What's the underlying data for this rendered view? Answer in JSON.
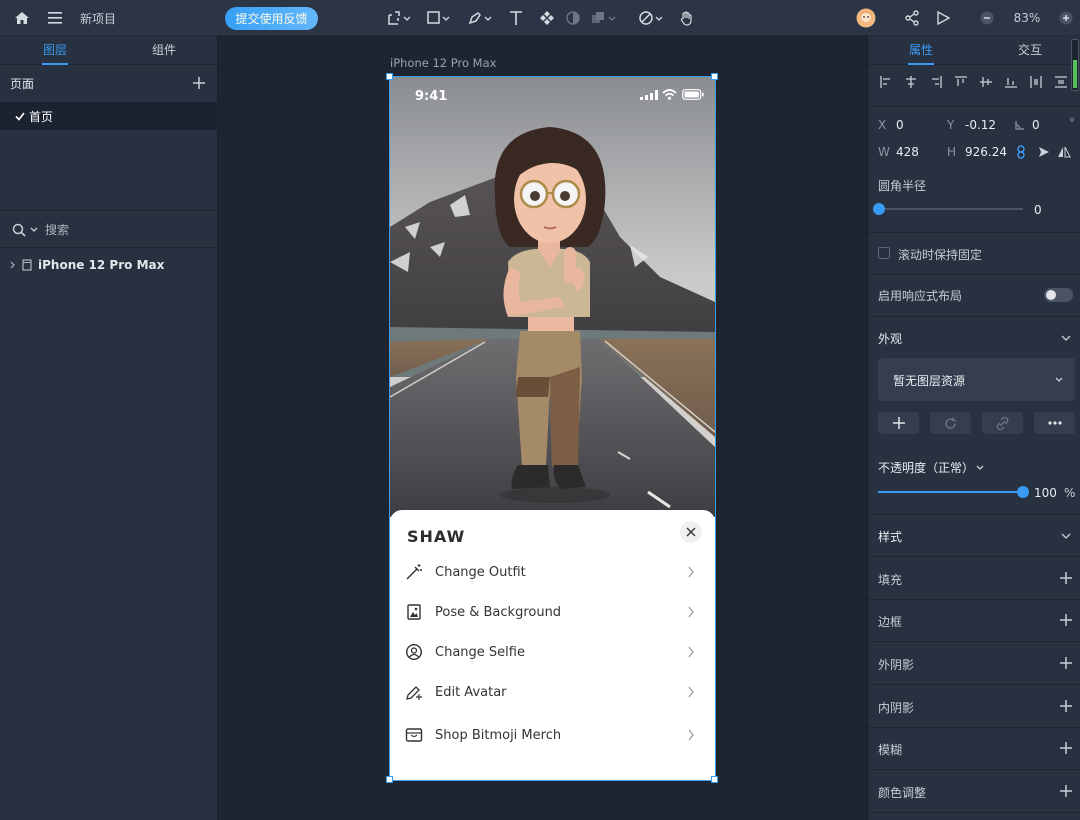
{
  "topbar": {
    "project_name": "新项目",
    "feedback_label": "提交使用反馈",
    "zoom": "83%"
  },
  "left_panel": {
    "tabs": [
      "图层",
      "组件"
    ],
    "pages_header": "页面",
    "page_item": "首页",
    "search_placeholder": "搜索",
    "layer_name": "iPhone 12 Pro Max"
  },
  "canvas": {
    "artboard_label": "iPhone 12 Pro Max",
    "phone": {
      "status_time": "9:41",
      "sheet_title": "SHAW",
      "menu": [
        {
          "label": "Change Outfit",
          "icon": "magic-wand-icon"
        },
        {
          "label": "Pose & Background",
          "icon": "image-icon"
        },
        {
          "label": "Change Selfie",
          "icon": "selfie-icon"
        },
        {
          "label": "Edit Avatar",
          "icon": "pencil-plus-icon"
        },
        {
          "label": "Shop Bitmoji Merch",
          "icon": "shop-icon"
        }
      ]
    }
  },
  "right_panel": {
    "tabs": [
      "属性",
      "交互"
    ],
    "x_label": "X",
    "x_value": "0",
    "y_label": "Y",
    "y_value": "-0.12",
    "rot_value": "0",
    "rot_unit": "°",
    "w_label": "W",
    "w_value": "428",
    "h_label": "H",
    "h_value": "926.24",
    "radius_label": "圆角半径",
    "radius_value": "0",
    "scroll_fixed_label": "滚动时保持固定",
    "responsive_label": "启用响应式布局",
    "appearance_label": "外观",
    "no_resource_label": "暂无图层资源",
    "opacity_label": "不透明度（正常）",
    "opacity_value": "100",
    "opacity_unit": "%",
    "opacity_fraction": 1.0,
    "style_label": "样式",
    "style_items": [
      "填充",
      "边框",
      "外阴影",
      "内阴影",
      "模糊",
      "颜色调整"
    ]
  },
  "colors": {
    "accent": "#3a9bf4",
    "panel": "#283140",
    "canvas": "#1e2430"
  }
}
